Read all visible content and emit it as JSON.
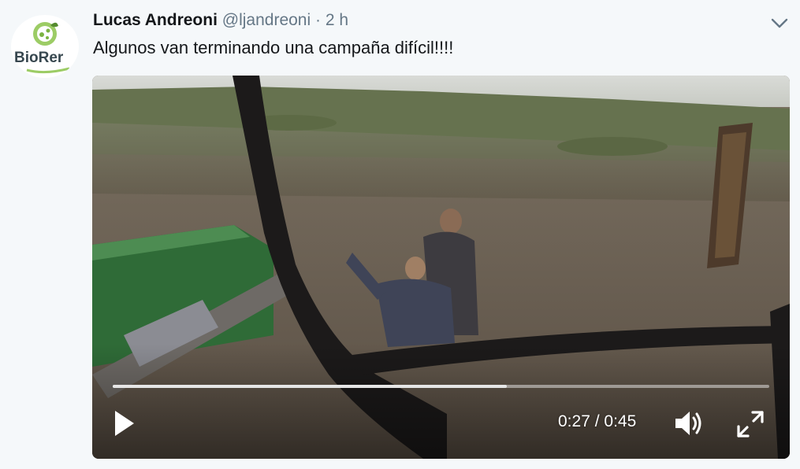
{
  "tweet": {
    "author_name": "Lucas Andreoni",
    "handle": "@ljandreoni",
    "separator": "·",
    "time_ago": "2 h",
    "text": "Algunos van terminando una campaña difícil!!!!",
    "avatar_logo_text": "BioRer"
  },
  "video": {
    "current_time": "0:27",
    "duration": "0:45",
    "time_separator": " / ",
    "progress_fraction": 0.6
  },
  "icons": {
    "menu": "chevron-down-icon",
    "play": "play-icon",
    "volume": "volume-icon",
    "fullscreen": "fullscreen-icon"
  },
  "colors": {
    "background": "#f5f8fa",
    "name": "#14171a",
    "secondary": "#657786",
    "logo_green": "#7cb342"
  }
}
